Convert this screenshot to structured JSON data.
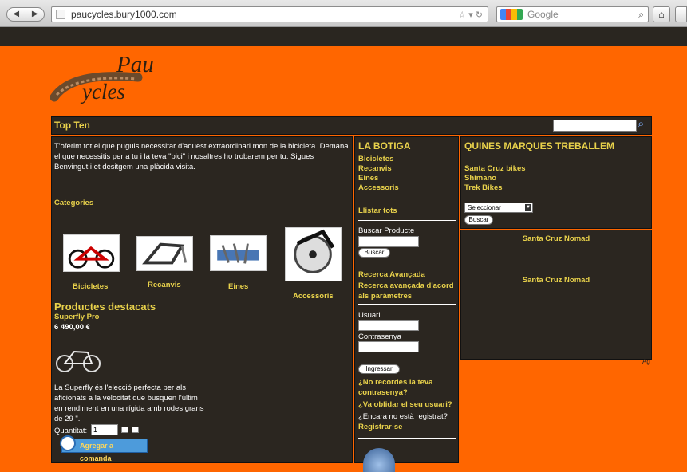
{
  "browser": {
    "url": "paucycles.bury1000.com",
    "search_placeholder": "Google"
  },
  "header": {
    "logo_line1": "Pau",
    "logo_line2": "ycles",
    "title": "Top Ten"
  },
  "left": {
    "intro": "T'oferim tot el que puguis necessitar d'aquest extraordinari mon de la bicicleta. Demana el que necessitis per a tu i la teva \"bici\" i nosaltres ho trobarem per tu. Sigues Benvingut i et desitgem una plàcida visita.",
    "categories_title": "Categories",
    "categories": [
      {
        "label": "Bicicletes",
        "icon": "bicycle-icon"
      },
      {
        "label": "Recanvis",
        "icon": "frame-icon"
      },
      {
        "label": "Eines",
        "icon": "tools-icon"
      },
      {
        "label": "Accessoris",
        "icon": "saw-icon"
      }
    ],
    "featured_title": "Productes destacats",
    "featured_name": "Superfly Pro",
    "featured_price": "6 490,00 €",
    "featured_desc": "La Superfly és l'elecció perfecta per als aficionats a la velocitat que busquen l'últim en rendiment en una rígida amb rodes grans de 29 \".",
    "quantity_label": "Quantitat:",
    "quantity_value": "1",
    "add_to_cart": "Agregar a comanda"
  },
  "middle": {
    "title": "LA BOTIGA",
    "links": [
      "Bicicletes",
      "Recanvis",
      "Eines",
      "Accessoris"
    ],
    "list_all": "Llistar tots",
    "search_label": "Buscar Producte",
    "search_button": "Buscar",
    "advanced": "Recerca Avançada",
    "advanced_params": "Recerca avançada d'acord als paràmetres",
    "user_label": "Usuari",
    "password_label": "Contrasenya",
    "login_button": "Ingressar",
    "forgot_password": "¿No recordes la teva contrasenya?",
    "forgot_user": "¿Va oblidar el seu usuari?",
    "not_registered": "¿Encara no està registrat?",
    "register": "Registrar-se"
  },
  "right": {
    "title": "QUINES MARQUES TREBALLEM",
    "brands": [
      "Santa Cruz bikes",
      "Shimano",
      "Trek Bikes"
    ],
    "select_value": "Seleccionar",
    "select_button": "Buscar",
    "products": [
      "Santa Cruz Nomad",
      "Santa Cruz Nomad"
    ],
    "ag": "Ag"
  },
  "colors": {
    "orange": "#ff6600",
    "panel": "#2b2620",
    "accent_yellow": "#e9d24b"
  }
}
